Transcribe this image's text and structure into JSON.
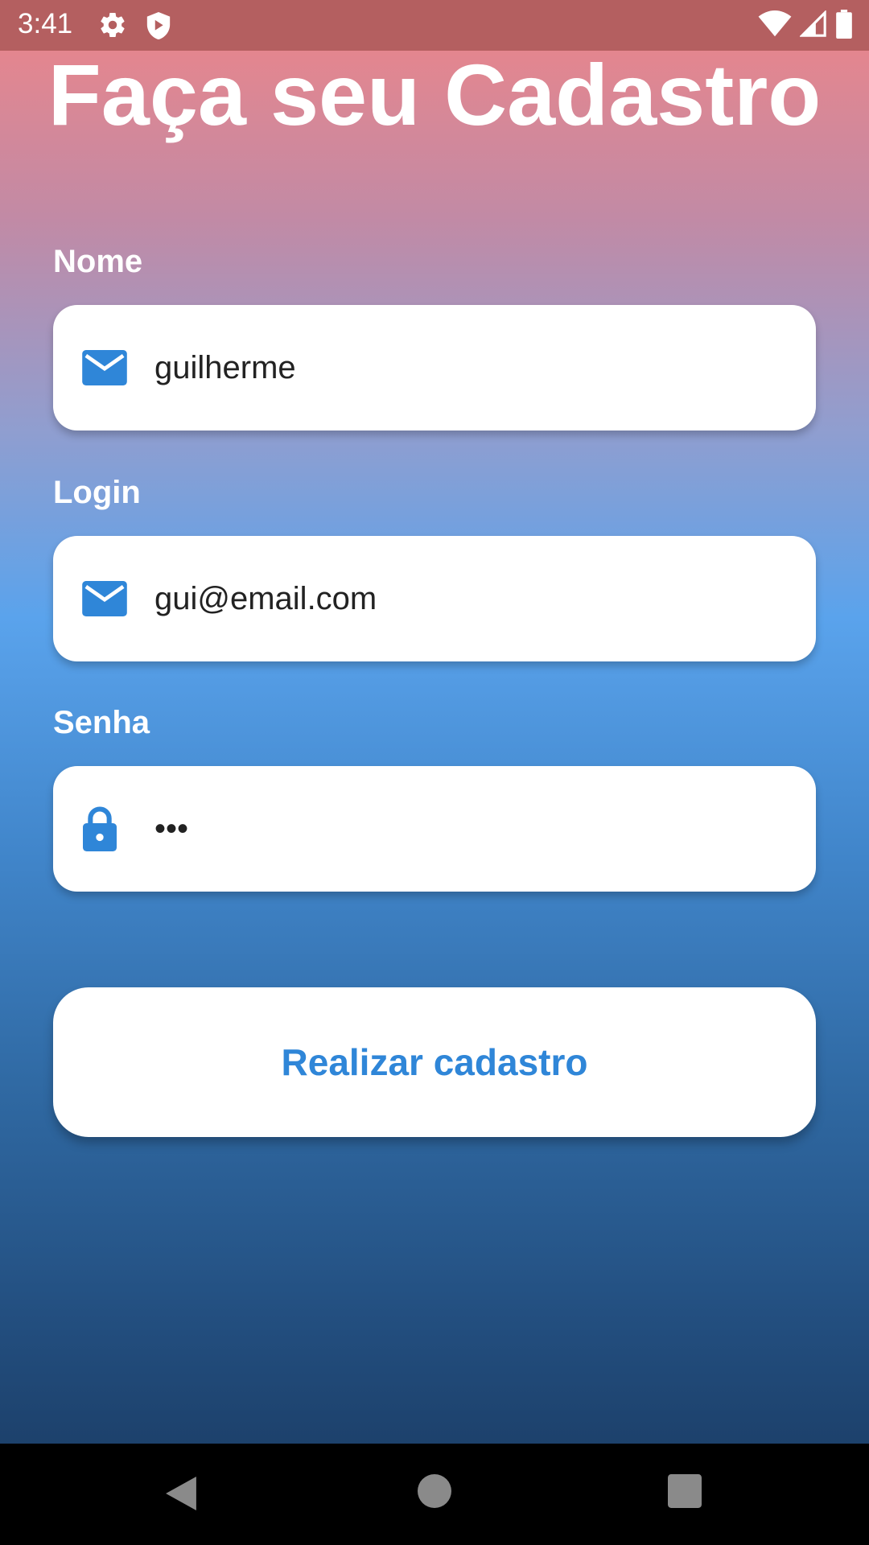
{
  "status_bar": {
    "time": "3:41",
    "left_icons": [
      "gear-icon",
      "shield-icon"
    ],
    "right_icons": [
      "wifi-icon",
      "signal-icon",
      "battery-icon"
    ]
  },
  "title": "Faça seu Cadastro",
  "form": {
    "name": {
      "label": "Nome",
      "value": "guilherme",
      "icon": "mail-icon"
    },
    "login": {
      "label": "Login",
      "value": "gui@email.com",
      "icon": "mail-icon"
    },
    "password": {
      "label": "Senha",
      "value": "•••",
      "icon": "lock-icon"
    }
  },
  "submit_label": "Realizar cadastro",
  "colors": {
    "accent": "#2f86d8",
    "gradient_top": "#ee8588",
    "gradient_bottom": "#1b3d66"
  },
  "nav": [
    "back-icon",
    "home-icon",
    "recents-icon"
  ]
}
